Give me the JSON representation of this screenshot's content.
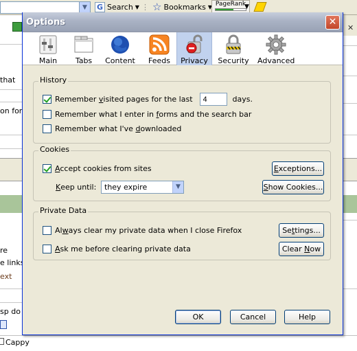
{
  "background": {
    "toolbar": {
      "search_label": "Search",
      "bookmarks_label": "Bookmarks",
      "pagerank_label": "PageRank",
      "pagerank_level": 0.6
    },
    "side_text": [
      {
        "text": "that",
        "brown": false
      },
      {
        "text": "on for",
        "brown": false
      },
      {
        "text": "re",
        "brown": false
      },
      {
        "text": "e links",
        "brown": false
      },
      {
        "text": "ext",
        "brown": true
      },
      {
        "text": "sp do",
        "brown": false
      }
    ],
    "bottom_checkbox_label": "Cappy"
  },
  "dialog": {
    "title": "Options",
    "close_glyph": "✕",
    "panes": [
      {
        "label": "Main",
        "icon": "main-icon"
      },
      {
        "label": "Tabs",
        "icon": "tabs-icon"
      },
      {
        "label": "Content",
        "icon": "globe-icon"
      },
      {
        "label": "Feeds",
        "icon": "rss-icon"
      },
      {
        "label": "Privacy",
        "icon": "privacy-lock-icon"
      },
      {
        "label": "Security",
        "icon": "padlock-icon"
      },
      {
        "label": "Advanced",
        "icon": "gear-icon"
      }
    ],
    "selected_pane": "Privacy",
    "history": {
      "title": "History",
      "visited": {
        "label_pre": "Remember ",
        "label_u": "v",
        "label_post": "isited pages for the last",
        "checked": true,
        "days_value": "4",
        "days_label": "days."
      },
      "forms": {
        "label_pre": "Remember what I enter in ",
        "label_u": "f",
        "label_post": "orms and the search bar",
        "checked": false
      },
      "downloads": {
        "label_pre": "Remember what I've ",
        "label_u": "d",
        "label_post": "ownloaded",
        "checked": false
      }
    },
    "cookies": {
      "title": "Cookies",
      "accept": {
        "label_pre": "",
        "label_u": "A",
        "label_post": "ccept cookies from sites",
        "checked": true
      },
      "keep_until_u": "K",
      "keep_until_post": "eep until:",
      "keep_until_value": "they expire",
      "exceptions_pre": "",
      "exceptions_u": "E",
      "exceptions_post": "xceptions...",
      "show_cookies_pre": "",
      "show_cookies_u": "S",
      "show_cookies_post": "how Cookies..."
    },
    "private_data": {
      "title": "Private Data",
      "always_clear": {
        "label_pre": "Al",
        "label_u": "w",
        "label_post": "ays clear my private data when I close Firefox",
        "checked": false
      },
      "ask_before": {
        "label_pre": "",
        "label_u": "A",
        "label_post": "sk me before clearing private data",
        "checked": false
      },
      "settings_pre": "Se",
      "settings_u": "t",
      "settings_post": "tings...",
      "clear_now_pre": "Clear ",
      "clear_now_u": "N",
      "clear_now_post": "ow"
    },
    "buttons": {
      "ok": "OK",
      "cancel": "Cancel",
      "help": "Help"
    }
  }
}
